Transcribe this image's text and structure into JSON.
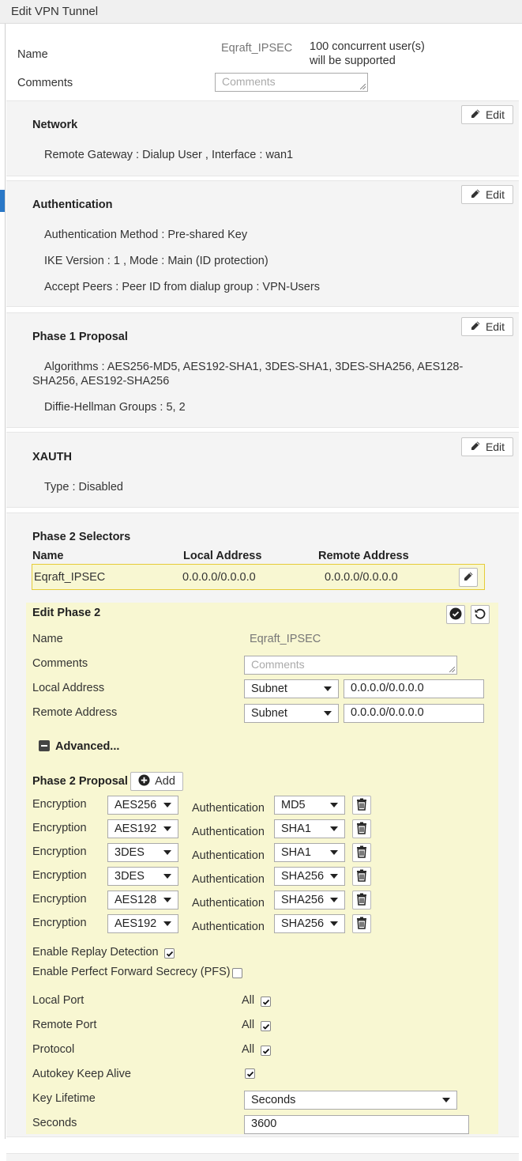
{
  "window": {
    "title": "Edit VPN Tunnel"
  },
  "general": {
    "name_label": "Name",
    "name_value": "Eqraft_IPSEC",
    "capacity_line1": "100 concurrent user(s)",
    "capacity_line2": "will be supported",
    "comments_label": "Comments",
    "comments_placeholder": "Comments"
  },
  "network": {
    "title": "Network",
    "edit_label": "Edit",
    "remote_gateway": "Remote Gateway : Dialup User , Interface : wan1"
  },
  "authentication": {
    "title": "Authentication",
    "edit_label": "Edit",
    "method": "Authentication Method : Pre-shared Key",
    "ike": "IKE Version : 1 , Mode : Main (ID protection)",
    "peers": "Accept Peers : Peer ID from dialup group : VPN-Users"
  },
  "phase1": {
    "title": "Phase 1 Proposal",
    "edit_label": "Edit",
    "algorithms_line1": "Algorithms : AES256-MD5, AES192-SHA1, 3DES-SHA1, 3DES-SHA256, AES128-",
    "algorithms_line2": "SHA256, AES192-SHA256",
    "dh_groups": "Diffie-Hellman Groups : 5, 2"
  },
  "xauth": {
    "title": "XAUTH",
    "edit_label": "Edit",
    "type": "Type : Disabled"
  },
  "phase2_selectors": {
    "title": "Phase 2 Selectors",
    "columns": [
      "Name",
      "Local Address",
      "Remote Address"
    ],
    "row": {
      "name": "Eqraft_IPSEC",
      "local": "0.0.0.0/0.0.0.0",
      "remote": "0.0.0.0/0.0.0.0"
    }
  },
  "edit_phase2": {
    "title": "Edit Phase 2",
    "name_label": "Name",
    "name_value": "Eqraft_IPSEC",
    "comments_label": "Comments",
    "comments_placeholder": "Comments",
    "local_address_label": "Local Address",
    "local_address_type": "Subnet",
    "local_address_value": "0.0.0.0/0.0.0.0",
    "remote_address_label": "Remote Address",
    "remote_address_type": "Subnet",
    "remote_address_value": "0.0.0.0/0.0.0.0",
    "advanced_label": "Advanced...",
    "proposal_label": "Phase 2 Proposal",
    "add_label": "Add",
    "encryption_label": "Encryption",
    "authentication_label": "Authentication",
    "proposals": [
      {
        "enc": "AES256",
        "auth": "MD5"
      },
      {
        "enc": "AES192",
        "auth": "SHA1"
      },
      {
        "enc": "3DES",
        "auth": "SHA1"
      },
      {
        "enc": "3DES",
        "auth": "SHA256"
      },
      {
        "enc": "AES128",
        "auth": "SHA256"
      },
      {
        "enc": "AES192",
        "auth": "SHA256"
      }
    ],
    "replay_label": "Enable Replay Detection",
    "replay_checked": true,
    "pfs_label": "Enable Perfect Forward Secrecy (PFS)",
    "pfs_checked": false,
    "local_port_label": "Local Port",
    "local_port_all": "All",
    "remote_port_label": "Remote Port",
    "remote_port_all": "All",
    "protocol_label": "Protocol",
    "protocol_all": "All",
    "keepalive_label": "Autokey Keep Alive",
    "keepalive_checked": true,
    "key_lifetime_label": "Key Lifetime",
    "key_lifetime_value": "Seconds",
    "seconds_label": "Seconds",
    "seconds_value": "3600"
  },
  "colors": {
    "panel_bg": "#f4f4f4",
    "highlight_bg": "#f8f7d2",
    "selector_border": "#e5cc38",
    "accent_tab": "#2a78c7"
  }
}
